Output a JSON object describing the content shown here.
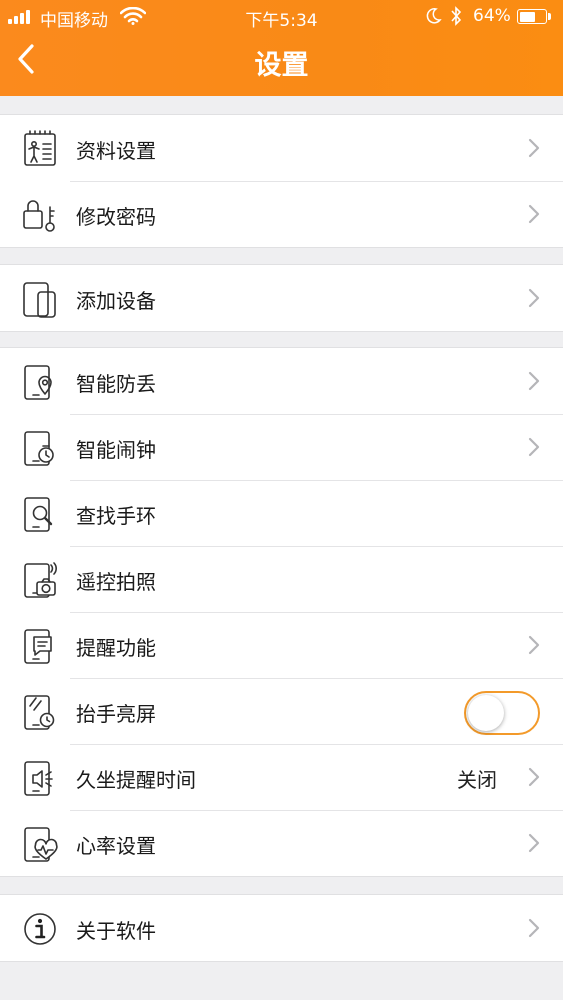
{
  "status_bar": {
    "carrier": "中国移动",
    "time": "下午5:34",
    "battery": "64%",
    "battery_level": 0.64
  },
  "nav": {
    "title": "设置"
  },
  "groups": [
    [
      {
        "label": "资料设置",
        "icon": "profile-card-icon",
        "chevron": true
      },
      {
        "label": "修改密码",
        "icon": "lock-key-icon",
        "chevron": true
      }
    ],
    [
      {
        "label": "添加设备",
        "icon": "devices-icon",
        "chevron": true
      }
    ],
    [
      {
        "label": "智能防丢",
        "icon": "anti-lost-icon",
        "chevron": true
      },
      {
        "label": "智能闹钟",
        "icon": "alarm-clock-icon",
        "chevron": true
      },
      {
        "label": "查找手环",
        "icon": "find-band-icon",
        "chevron": false
      },
      {
        "label": "遥控拍照",
        "icon": "remote-camera-icon",
        "chevron": false
      },
      {
        "label": "提醒功能",
        "icon": "reminder-icon",
        "chevron": true
      },
      {
        "label": "抬手亮屏",
        "icon": "raise-wake-icon",
        "chevron": false,
        "toggle": false
      },
      {
        "label": "久坐提醒时间",
        "icon": "sedentary-icon",
        "chevron": true,
        "value": "关闭"
      },
      {
        "label": "心率设置",
        "icon": "heart-rate-icon",
        "chevron": true
      }
    ],
    [
      {
        "label": "关于软件",
        "icon": "info-icon",
        "chevron": true
      }
    ]
  ]
}
